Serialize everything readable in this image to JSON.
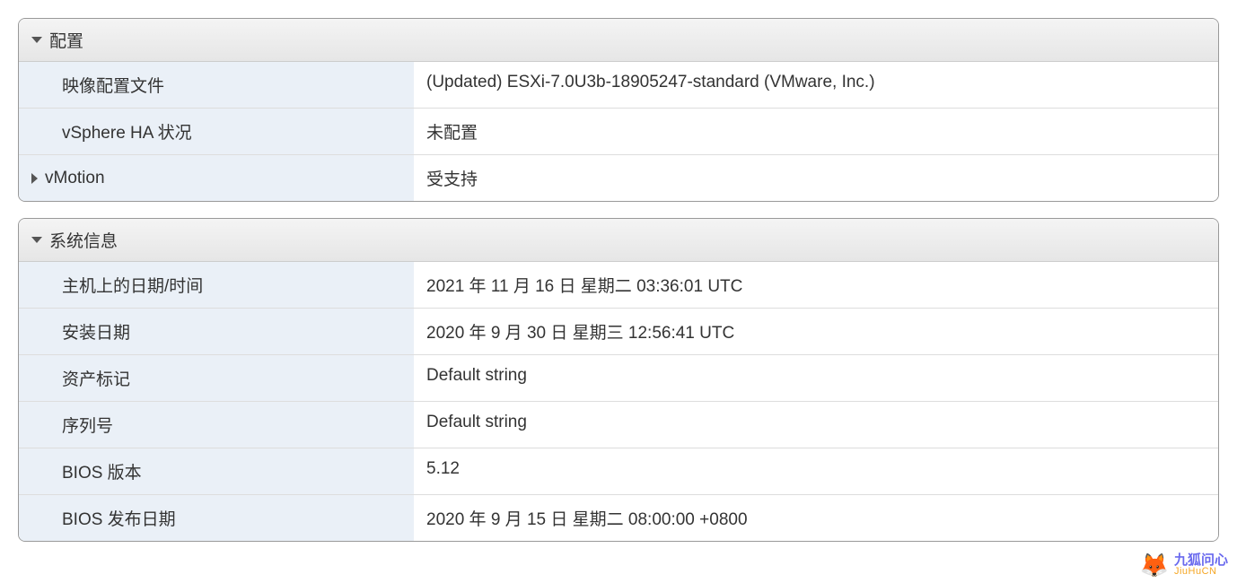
{
  "panels": {
    "config": {
      "title": "配置",
      "rows": {
        "image_profile": {
          "label": "映像配置文件",
          "value": "(Updated) ESXi-7.0U3b-18905247-standard (VMware, Inc.)"
        },
        "ha_status": {
          "label": "vSphere HA 状况",
          "value": "未配置"
        },
        "vmotion": {
          "label": "vMotion",
          "value": "受支持"
        }
      }
    },
    "sysinfo": {
      "title": "系统信息",
      "rows": {
        "host_datetime": {
          "label": "主机上的日期/时间",
          "value": "2021 年 11 月 16 日 星期二 03:36:01 UTC"
        },
        "install_date": {
          "label": "安装日期",
          "value": "2020 年 9 月 30 日 星期三 12:56:41 UTC"
        },
        "asset_tag": {
          "label": "资产标记",
          "value": "Default string"
        },
        "serial": {
          "label": "序列号",
          "value": "Default string"
        },
        "bios_version": {
          "label": "BIOS 版本",
          "value": "5.12"
        },
        "bios_date": {
          "label": "BIOS 发布日期",
          "value": "2020 年 9 月 15 日 星期二 08:00:00 +0800"
        }
      }
    }
  },
  "watermark": {
    "cn": "九狐问心",
    "en": "JiuHuCN"
  }
}
